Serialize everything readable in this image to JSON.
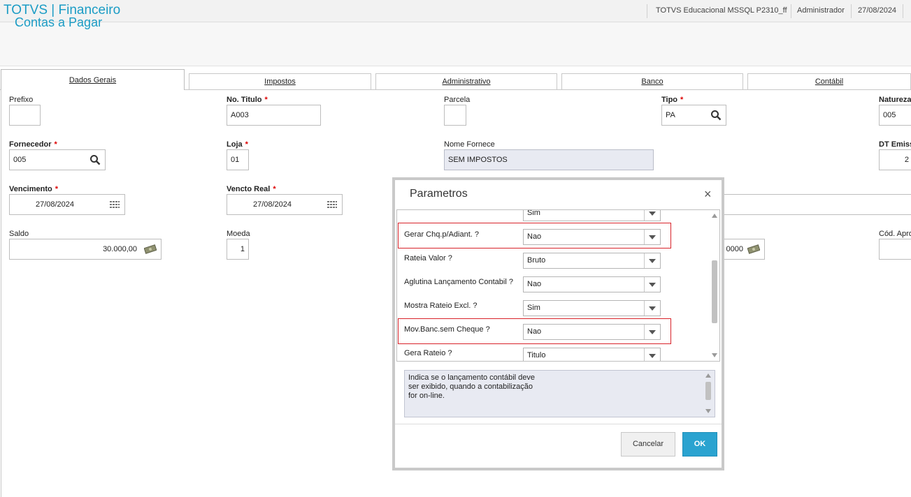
{
  "app": {
    "title": "TOTVS | Financeiro"
  },
  "topbar": {
    "environment": "TOTVS Educacional MSSQL P2310_ff",
    "user": "Administrador",
    "date": "27/08/2024"
  },
  "page": {
    "title": "Contas a Pagar"
  },
  "tabs": [
    {
      "label": "Dados Gerais",
      "active": true
    },
    {
      "label": "Impostos"
    },
    {
      "label": "Administrativo"
    },
    {
      "label": "Banco"
    },
    {
      "label": "Contábil"
    }
  ],
  "form": {
    "prefixo": {
      "label": "Prefixo",
      "value": ""
    },
    "no_titulo": {
      "label": "No. Titulo",
      "value": "A003"
    },
    "parcela": {
      "label": "Parcela",
      "value": ""
    },
    "tipo": {
      "label": "Tipo",
      "value": "PA"
    },
    "natureza": {
      "label": "Natureza",
      "value": "005"
    },
    "fornecedor": {
      "label": "Fornecedor",
      "value": "005"
    },
    "loja": {
      "label": "Loja",
      "value": "01"
    },
    "nome_fornece": {
      "label": "Nome Fornece",
      "value": "SEM IMPOSTOS"
    },
    "dt_emissao": {
      "label": "DT Emiss",
      "value": "2"
    },
    "vencimento": {
      "label": "Vencimento",
      "value": "27/08/2024"
    },
    "vencto_real": {
      "label": "Vencto Real",
      "value": "27/08/2024"
    },
    "saldo": {
      "label": "Saldo",
      "value": "30.000,00"
    },
    "moeda": {
      "label": "Moeda",
      "value": "1"
    },
    "taxa": {
      "value": "0000"
    },
    "cod_apro": {
      "label": "Cód. Apro",
      "value": ""
    }
  },
  "dialog": {
    "title": "Parametros",
    "close_label": "×",
    "params": [
      {
        "label": "",
        "value": "Sim"
      },
      {
        "label": "Gerar Chq.p/Adiant. ?",
        "value": "Nao",
        "highlighted": true
      },
      {
        "label": "Rateia Valor ?",
        "value": "Bruto"
      },
      {
        "label": "Aglutina Lançamento Contabil ?",
        "value": "Nao"
      },
      {
        "label": "Mostra Rateio Excl. ?",
        "value": "Sim"
      },
      {
        "label": "Mov.Banc.sem Cheque ?",
        "value": "Nao",
        "highlighted": true
      },
      {
        "label": "Gera Rateio ?",
        "value": "Titulo"
      }
    ],
    "help_lines": [
      "Indica se o lançamento contábil deve",
      "ser exibido, quando a contabilização",
      "for on-line."
    ],
    "cancel_label": "Cancelar",
    "ok_label": "OK"
  }
}
